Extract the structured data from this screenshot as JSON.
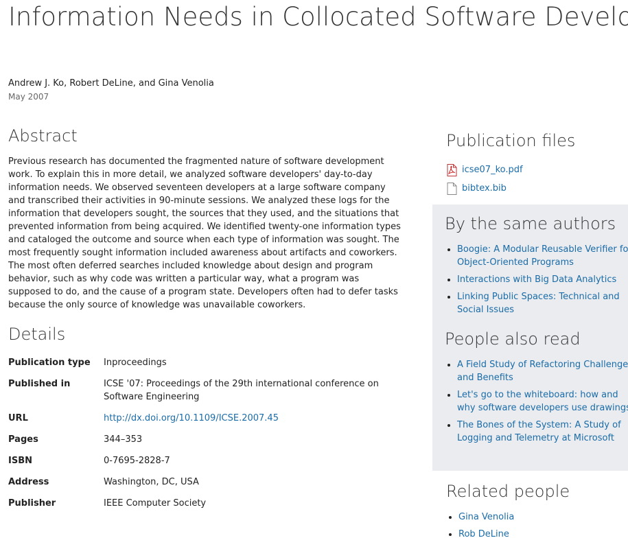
{
  "title": "Information Needs in Collocated Software Development Teams",
  "authors": "Andrew J. Ko, Robert DeLine, and Gina Venolia",
  "date": "May 2007",
  "abstract": {
    "heading": "Abstract",
    "text": "Previous research has documented the fragmented nature of software development work. To explain this in more detail, we analyzed software developers' day-to-day information needs. We observed seventeen developers at a large software company and transcribed their activities in 90-minute sessions. We analyzed these logs for the information that developers sought, the sources that they used, and the situations that prevented information from being acquired. We identified twenty-one information types and cataloged the outcome and source when each type of information was sought. The most frequently sought information included awareness about artifacts and coworkers. The most often deferred searches included knowledge about design and program behavior, such as why code was written a particular way, what a program was supposed to do, and the cause of a program state. Developers often had to defer tasks because the only source of knowledge was unavailable coworkers."
  },
  "details": {
    "heading": "Details",
    "rows": [
      {
        "label": "Publication type",
        "value": "Inproceedings"
      },
      {
        "label": "Published in",
        "value": "ICSE '07: Proceedings of the 29th international conference on Software Engineering"
      },
      {
        "label": "URL",
        "value": "http://dx.doi.org/10.1109/ICSE.2007.45"
      },
      {
        "label": "Pages",
        "value": "344–353"
      },
      {
        "label": "ISBN",
        "value": "0-7695-2828-7"
      },
      {
        "label": "Address",
        "value": "Washington, DC, USA"
      },
      {
        "label": "Publisher",
        "value": "IEEE Computer Society"
      }
    ]
  },
  "publication_files": {
    "heading": "Publication files",
    "files": [
      {
        "name": "icse07_ko.pdf",
        "icon": "pdf-file-icon"
      },
      {
        "name": "bibtex.bib",
        "icon": "document-file-icon"
      }
    ]
  },
  "same_authors": {
    "heading": "By the same authors",
    "items": [
      "Boogie: A Modular Reusable Verifier for Object-Oriented Programs",
      "Interactions with Big Data Analytics",
      "Linking Public Spaces: Technical and Social Issues"
    ]
  },
  "also_read": {
    "heading": "People also read",
    "items": [
      "A Field Study of Refactoring Challenges and Benefits",
      "Let's go to the whiteboard: how and why software developers use drawings",
      "The Bones of the System: A Study of Logging and Telemetry at Microsoft"
    ]
  },
  "related_people": {
    "heading": "Related people",
    "items": [
      "Gina Venolia",
      "Rob DeLine"
    ]
  },
  "colors": {
    "link": "#1a6ca8",
    "sidebar_background": "#eaecef",
    "pdf_icon": "#cc2222"
  }
}
